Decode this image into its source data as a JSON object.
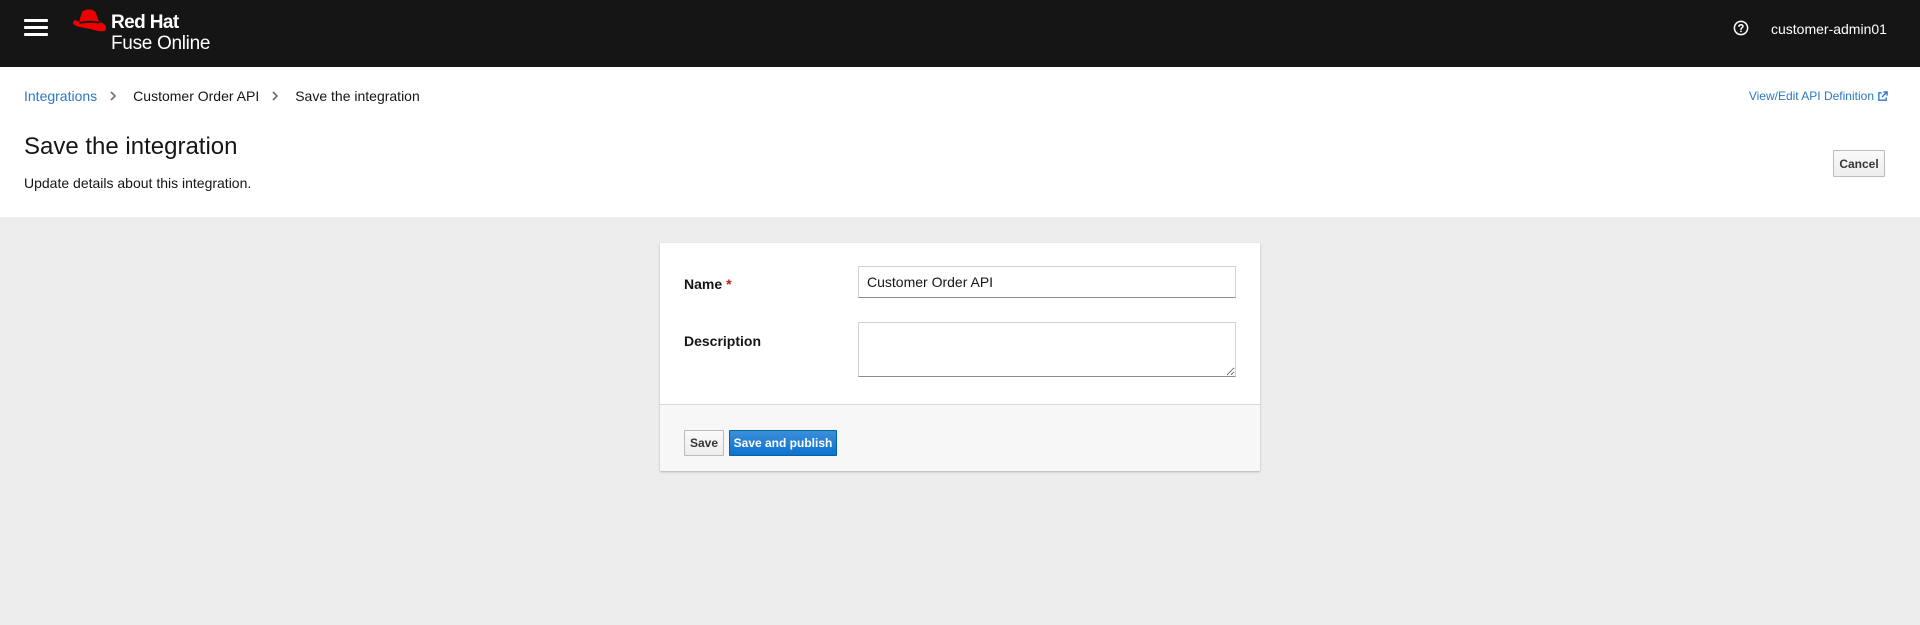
{
  "masthead": {
    "brand": "Red Hat",
    "product": "Fuse Online",
    "user": "customer-admin01",
    "icons": {
      "menu": "hamburger-icon",
      "help": "question-circle-icon",
      "logo": "red-hat-fedora-icon"
    }
  },
  "breadcrumb": {
    "items": [
      "Integrations",
      "Customer Order API"
    ],
    "current": "Save the integration"
  },
  "header": {
    "api_link": "View/Edit API Definition",
    "title": "Save the integration",
    "description": "Update details about this integration.",
    "cancel_label": "Cancel"
  },
  "form": {
    "name_label": "Name",
    "required_mark": "*",
    "name_value": "Customer Order API",
    "description_label": "Description",
    "description_value": "",
    "save_label": "Save",
    "publish_label": "Save and publish"
  },
  "colors": {
    "masthead_bg": "#151515",
    "link": "#2b78c5",
    "primary": "#0e72cf",
    "required": "#c9190b",
    "logo_red": "#ee0000"
  }
}
